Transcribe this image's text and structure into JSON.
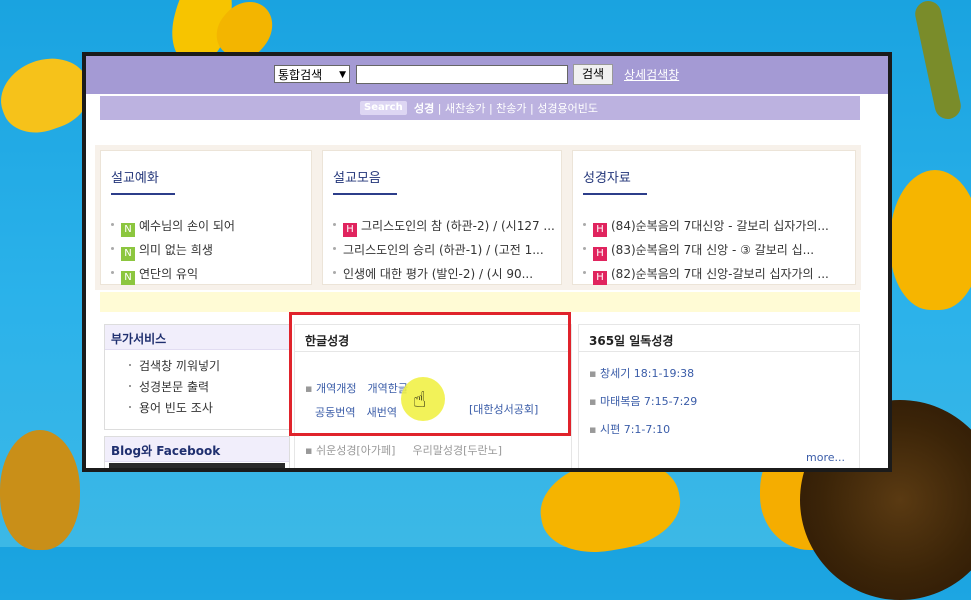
{
  "search": {
    "select_value": "통합검색",
    "button_label": "검색",
    "advanced_link": "상세검색창"
  },
  "subnav": {
    "badge": "Search",
    "items": [
      "성경",
      "새찬송가",
      "찬송가",
      "성경용어빈도"
    ]
  },
  "cards": [
    {
      "title": "설교예화",
      "items": [
        {
          "tag": "N",
          "text": "예수님의 손이 되어"
        },
        {
          "tag": "N",
          "text": "의미 없는 희생"
        },
        {
          "tag": "N",
          "text": "연단의 유익"
        }
      ]
    },
    {
      "title": "설교모음",
      "items": [
        {
          "tag": "H",
          "text": "그리스도인의 참 (하관-2) / (시127 ..."
        },
        {
          "tag": "",
          "text": "그리스도인의 승리 (하관-1) / (고전 1..."
        },
        {
          "tag": "",
          "text": "인생에 대한 평가 (발인-2) / (시 90..."
        }
      ]
    },
    {
      "title": "성경자료",
      "items": [
        {
          "tag": "H",
          "text": "(84)순복음의 7대신앙 - 갈보리 십자가의..."
        },
        {
          "tag": "H",
          "text": "(83)순복음의 7대 신앙 - ③ 갈보리 십..."
        },
        {
          "tag": "H",
          "text": "(82)순복음의 7대 신앙-갈보리 십자가의 ..."
        }
      ]
    }
  ],
  "extra_services": {
    "title": "부가서비스",
    "items": [
      "검색창 끼워넣기",
      "성경본문 출력",
      "용어 빈도 조사"
    ]
  },
  "blog": {
    "title": "Blog와 Facebook"
  },
  "korean_bible": {
    "title": "한글성경",
    "row1": [
      "개역개정",
      "개역한글"
    ],
    "row2": [
      "공동번역",
      "새번역"
    ],
    "publisher": "[대한성서공회]",
    "row3": [
      "쉬운성경[아가페]",
      "우리말성경[두란노]"
    ]
  },
  "daily_reading": {
    "title": "365일 일독성경",
    "items": [
      "창세기 18:1-19:38",
      "마태복음 7:15-7:29",
      "시편 7:1-7:10"
    ],
    "more": "more..."
  },
  "colors": {
    "topbar": "#a49ad4",
    "subbar": "#bcb2e0",
    "highlight_box": "#e0232b",
    "new_tag": "#8cc63f",
    "hot_tag": "#e0245e"
  }
}
